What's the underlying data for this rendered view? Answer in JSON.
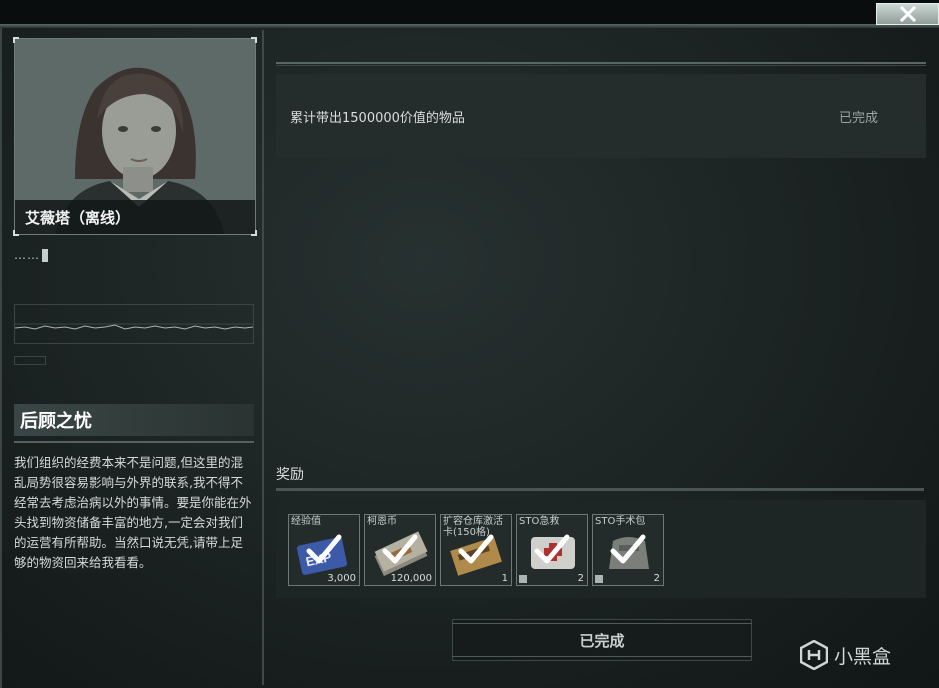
{
  "trader": {
    "name_status": "艾薇塔（离线）",
    "typing_text": "……"
  },
  "quest": {
    "title": "后顾之忧",
    "description": "我们组织的经费本来不是问题,但这里的混乱局势很容易影响与外界的联系,我不得不经常去考虑治病以外的事情。要是你能在外头找到物资储备丰富的地方,一定会对我们的运营有所帮助。当然口说无凭,请带上足够的物资回来给我看看。"
  },
  "objective": {
    "text": "累计带出1500000价值的物品",
    "status": "已完成"
  },
  "rewards": {
    "label": "奖励",
    "items": [
      {
        "name": "经验值",
        "count": "3,000",
        "icon": "exp-card-icon"
      },
      {
        "name": "柯恩币",
        "count": "120,000",
        "icon": "currency-stack-icon"
      },
      {
        "name": "扩容仓库激活\n卡(150格)",
        "count": "1",
        "icon": "storage-card-icon"
      },
      {
        "name": "STO急救",
        "count": "2",
        "icon": "first-aid-kit-icon"
      },
      {
        "name": "STO手术包",
        "count": "2",
        "icon": "surgery-kit-icon"
      }
    ]
  },
  "complete_button": "已完成",
  "watermark": "小黑盒",
  "colors": {
    "panel_bg": "#1b2222",
    "accent_line": "#5a6663",
    "text": "#d4dbd9"
  }
}
